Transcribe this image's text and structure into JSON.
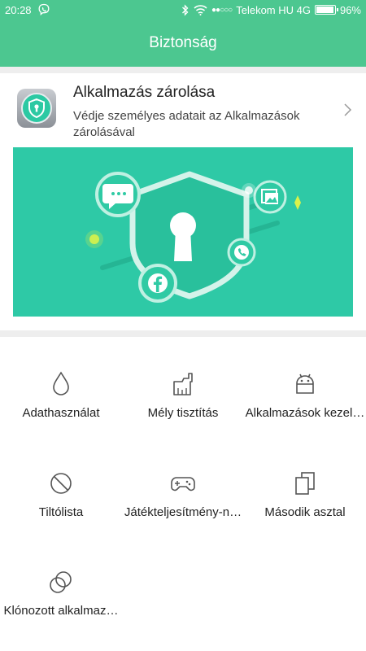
{
  "status_bar": {
    "time": "20:28",
    "carrier": "Telekom HU 4G",
    "battery": "96%",
    "battery_level": 0.96
  },
  "app_bar": {
    "title": "Biztonság"
  },
  "app_lock": {
    "title": "Alkalmazás zárolása",
    "description": "Védje személyes adatait az Alkalmazások zárolásával"
  },
  "tools": [
    {
      "label": "Adathasználat",
      "icon": "water-drop-icon"
    },
    {
      "label": "Mély tisztítás",
      "icon": "broom-icon"
    },
    {
      "label": "Alkalmazások kezel…",
      "icon": "android-icon"
    },
    {
      "label": "Tiltólista",
      "icon": "block-icon"
    },
    {
      "label": "Játékteljesítmény-n…",
      "icon": "gamepad-icon"
    },
    {
      "label": "Második asztal",
      "icon": "dual-screen-icon"
    },
    {
      "label": "Klónozott alkalmaz…",
      "icon": "clone-icon"
    }
  ],
  "colors": {
    "primary": "#4cc790",
    "banner": "#2ec9a6",
    "icon_gray": "#555555"
  }
}
